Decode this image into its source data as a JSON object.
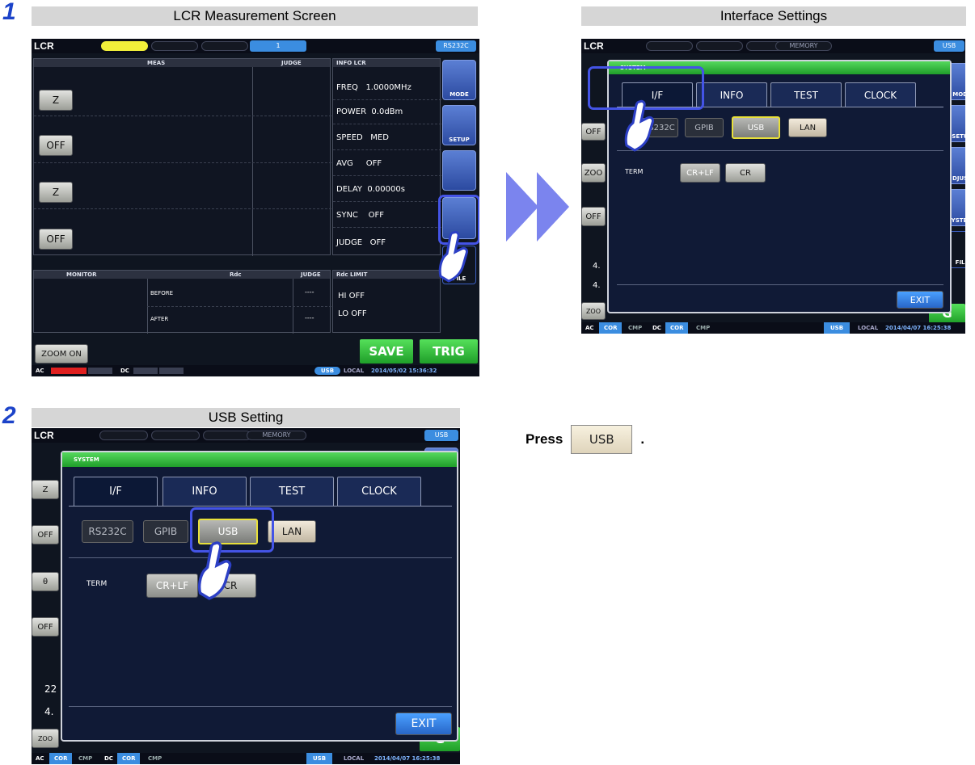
{
  "steps": [
    {
      "number": "1",
      "left_title": "LCR Measurement Screen",
      "right_title": "Interface Settings"
    },
    {
      "number": "2",
      "title": "USB Setting"
    }
  ],
  "instruction": {
    "prefix": "Press",
    "button": "USB",
    "suffix": "."
  },
  "lcr_screen": {
    "mode_label": "LCR",
    "tab_active": "1",
    "interface_badge": "RS232C",
    "meas_header": "MEAS",
    "judge_header": "JUDGE",
    "param_buttons": [
      "Z",
      "OFF",
      "Z",
      "OFF"
    ],
    "info_header": "INFO LCR",
    "info_rows": [
      {
        "label": "FREQ",
        "value": "1.0000MHz"
      },
      {
        "label": "POWER",
        "value": "0.0dBm"
      },
      {
        "label": "SPEED",
        "value": "MED"
      },
      {
        "label": "AVG",
        "value": "OFF"
      },
      {
        "label": "DELAY",
        "value": "0.00000s"
      },
      {
        "label": "SYNC",
        "value": "OFF"
      },
      {
        "label": "JUDGE",
        "value": "OFF"
      }
    ],
    "side_buttons": [
      "MODE",
      "SETUP",
      "",
      "",
      "FILE"
    ],
    "monitor_header": "MONITOR",
    "rdc_header": "Rdc",
    "rdc_judge_header": "JUDGE",
    "rdc_rows": [
      {
        "label": "BEFORE",
        "judge": "----"
      },
      {
        "label": "AFTER",
        "judge": "----"
      }
    ],
    "rdc_limit_header": "Rdc LIMIT",
    "rdc_limit": [
      "HI  OFF",
      "LO  OFF"
    ],
    "zoom_button": "ZOOM ON",
    "save_button": "SAVE",
    "trig_button": "TRIG",
    "status": {
      "ac": "AC",
      "dc": "DC",
      "iface": "USB",
      "remote": "LOCAL",
      "datetime": "2014/05/02 15:36:32"
    }
  },
  "system_dialog": {
    "dialog_title": "SYSTEM",
    "tabs": [
      "I/F",
      "INFO",
      "TEST",
      "CLOCK"
    ],
    "interfaces": [
      "RS232C",
      "GPIB",
      "USB",
      "LAN"
    ],
    "term_label": "TERM",
    "term_options": [
      "CR+LF",
      "CR"
    ],
    "exit_button": "EXIT",
    "top_label": "LCR",
    "top_memory": "MEMORY",
    "top_iface": "USB",
    "side_labels": [
      "MODE",
      "SETUP",
      "DJUST",
      "YSTEM",
      "FILE"
    ],
    "status": {
      "ac": "AC",
      "dc": "DC",
      "cmp": "CMP",
      "cor": "COR",
      "iface": "USB",
      "remote": "LOCAL",
      "datetime": "2014/04/07 16:25:38"
    },
    "hidden_left_fragments": [
      "OFF",
      "OFF",
      "22",
      "4.",
      "Z",
      "θ",
      "ZOO",
      "G"
    ]
  }
}
